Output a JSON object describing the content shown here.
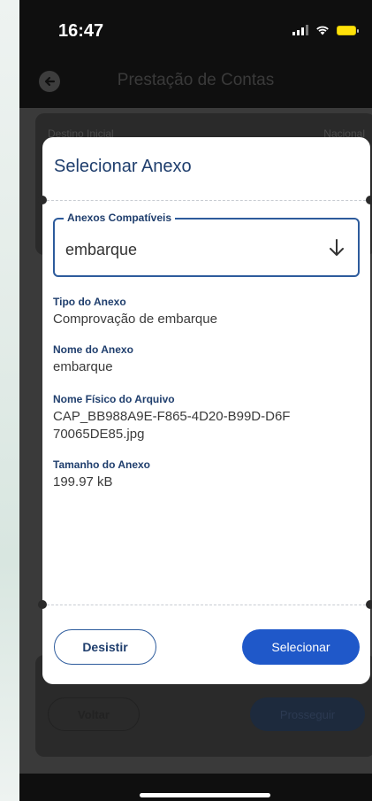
{
  "status_bar": {
    "time": "16:47",
    "icons": [
      "signal-icon",
      "wifi-icon",
      "battery-icon"
    ]
  },
  "app_bar": {
    "back_icon": "arrow-left-circle-icon",
    "title": "Prestação de Contas"
  },
  "background_form": {
    "field_label": "Destino Inicial",
    "field_value": "Nacional",
    "back_button": "Voltar",
    "next_button": "Prosseguir"
  },
  "modal": {
    "title": "Selecionar Anexo",
    "select": {
      "label": "Anexos Compatíveis",
      "value": "embarque",
      "icon": "arrow-down-icon"
    },
    "details": [
      {
        "label": "Tipo do Anexo",
        "value": "Comprovação de embarque"
      },
      {
        "label": "Nome do Anexo",
        "value": "embarque"
      },
      {
        "label": "Nome Físico do Arquivo",
        "value": "CAP_BB988A9E-F865-4D20-B99D-D6F70065DE85.jpg"
      },
      {
        "label": "Tamanho do Anexo",
        "value": "199.97 kB"
      }
    ],
    "cancel_button": "Desistir",
    "confirm_button": "Selecionar"
  },
  "colors": {
    "primary": "#1f58c9",
    "heading": "#1f3e6d",
    "border": "#2d5b9c"
  }
}
